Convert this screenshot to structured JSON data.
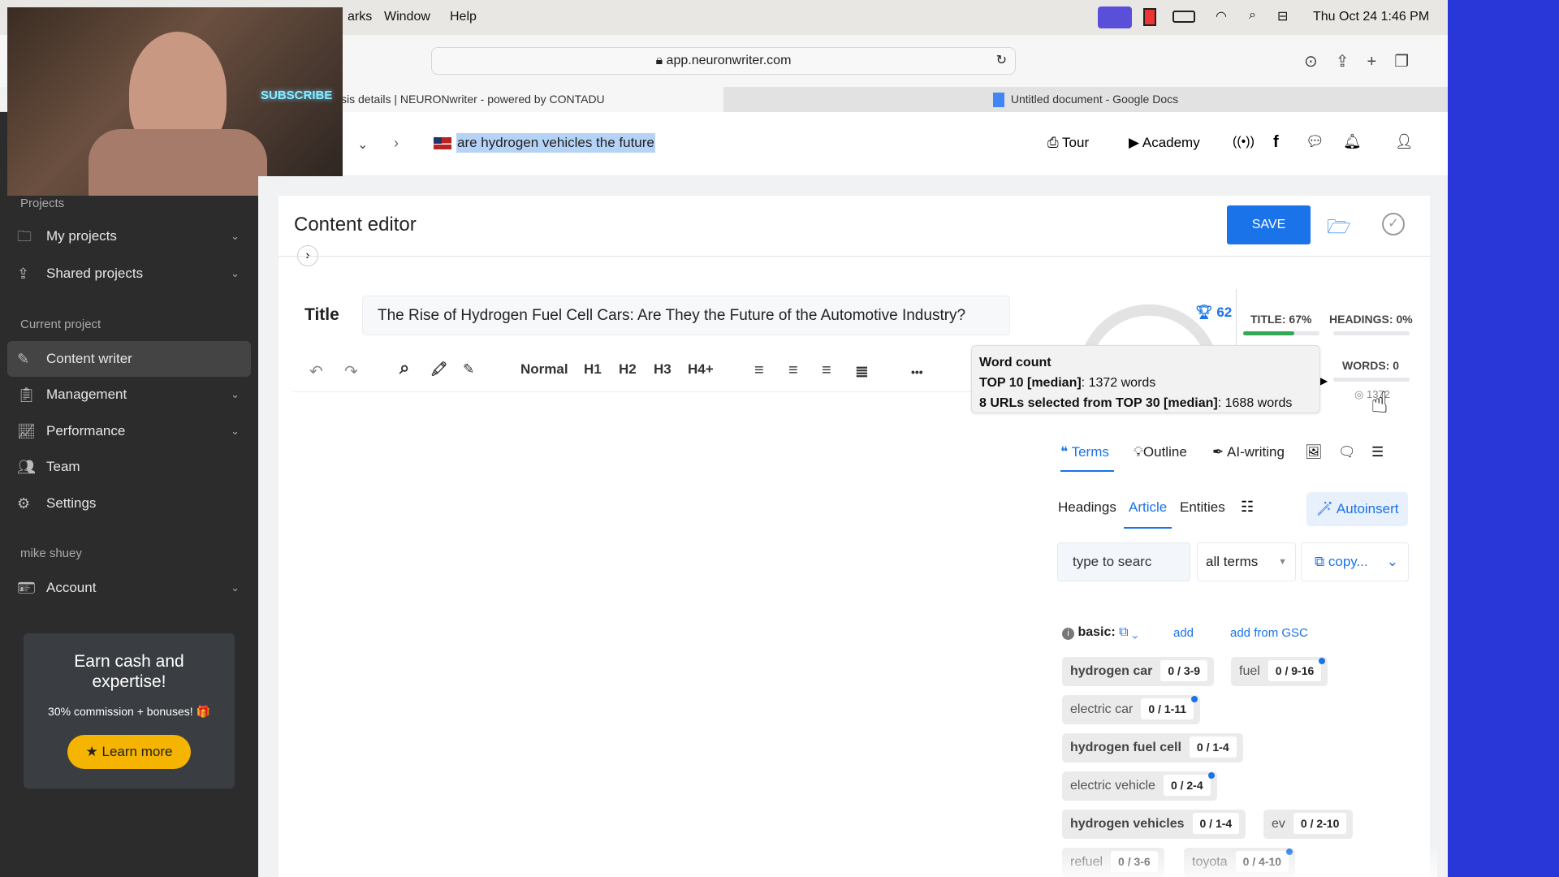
{
  "menubar": {
    "items": [
      "arks",
      "Window",
      "Help"
    ],
    "datetime": "Thu Oct 24  1:46 PM"
  },
  "browser": {
    "url": "app.neuronwriter.com",
    "tabs": [
      {
        "label": "sis details | NEURONwriter - powered by CONTADU"
      },
      {
        "label": "Untitled document - Google Docs"
      }
    ]
  },
  "webcam": {
    "sign": "SUBSCRIBE"
  },
  "header": {
    "query": "are hydrogen vehicles the future",
    "tour": "Tour",
    "academy": "Academy"
  },
  "sidebar": {
    "projects_label": "Projects",
    "my_projects": "My projects",
    "shared_projects": "Shared projects",
    "current_label": "Current project",
    "content_writer": "Content writer",
    "management": "Management",
    "performance": "Performance",
    "team": "Team",
    "settings": "Settings",
    "user": "mike shuey",
    "account": "Account",
    "promo": {
      "title": "Earn cash and expertise!",
      "subtitle": "30% commission + bonuses! 🎁",
      "button": "Learn more"
    }
  },
  "editor": {
    "heading": "Content editor",
    "save": "SAVE",
    "title_label": "Title",
    "title_value": "The Rise of Hydrogen Fuel Cell Cars: Are They the Future of the Automotive Industry?",
    "toolbar": {
      "normal": "Normal",
      "h1": "H1",
      "h2": "H2",
      "h3": "H3",
      "h4": "H4+",
      "more": "•••"
    }
  },
  "score": {
    "value": "62",
    "title": "TITLE: 67%",
    "title_pct": 67,
    "headings": "HEADINGS: 0%",
    "headings_pct": 0,
    "words": "WORDS: 0",
    "words_pct": 0,
    "target": "1372"
  },
  "tooltip": {
    "title": "Word count",
    "line1_bold": "TOP 10 [median]",
    "line1": ": 1372 words",
    "line2_bold": "8 URLs selected from TOP 30 [median]",
    "line2": ": 1688 words"
  },
  "panel": {
    "tabs": [
      "Terms",
      "Outline",
      "AI-writing"
    ],
    "subtabs": [
      "Headings",
      "Article",
      "Entities"
    ],
    "autoinsert": "Autoinsert",
    "search_placeholder": "type to searc",
    "filter": "all terms",
    "copy": "copy...",
    "basic": "basic:",
    "add": "add",
    "add_gsc": "add from GSC",
    "terms": [
      {
        "term": "hydrogen car",
        "count": "0 / 3-9",
        "bold": true,
        "dot": false
      },
      {
        "term": "fuel",
        "count": "0 / 9-16",
        "bold": false,
        "dot": true
      },
      {
        "term": "electric car",
        "count": "0 / 1-11",
        "bold": false,
        "dot": true
      },
      {
        "term": "hydrogen fuel cell",
        "count": "0 / 1-4",
        "bold": true,
        "dot": false
      },
      {
        "term": "electric vehicle",
        "count": "0 / 2-4",
        "bold": false,
        "dot": true
      },
      {
        "term": "hydrogen vehicles",
        "count": "0 / 1-4",
        "bold": true,
        "dot": false
      },
      {
        "term": "ev",
        "count": "0 / 2-10",
        "bold": false,
        "dot": false
      },
      {
        "term": "refuel",
        "count": "0 / 3-6",
        "bold": false,
        "dot": false
      },
      {
        "term": "toyota",
        "count": "0 / 4-10",
        "bold": false,
        "dot": true
      }
    ]
  },
  "colors": {
    "accent": "#1a73e8",
    "sidebar": "#2c2c2c",
    "promo_button": "#f5b400",
    "progress": "#34a853"
  }
}
